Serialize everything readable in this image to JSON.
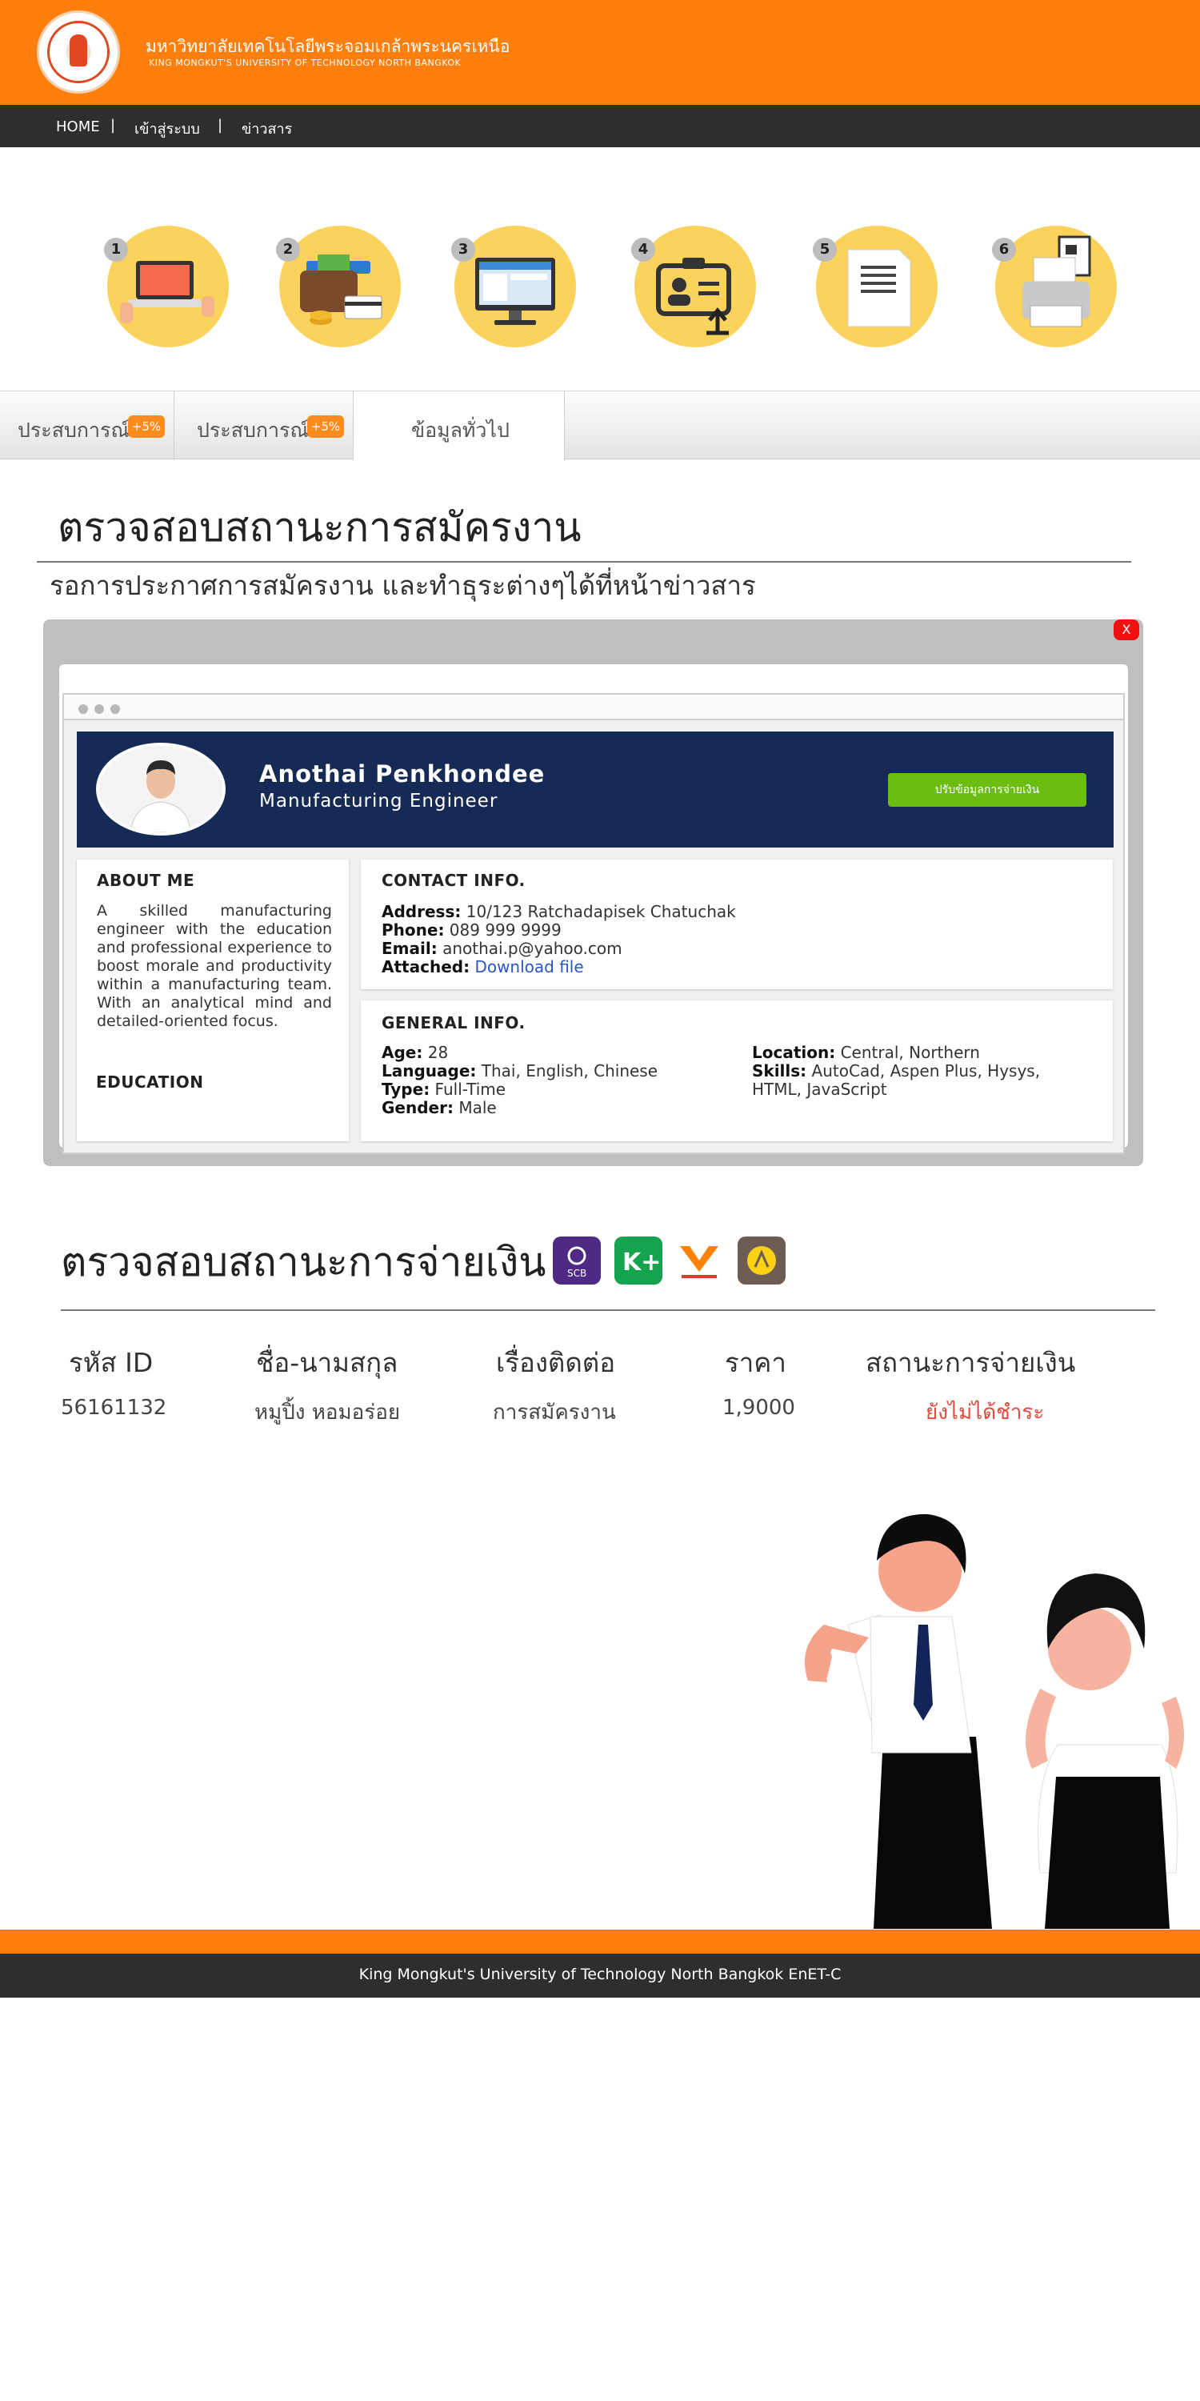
{
  "header": {
    "university_th": "มหาวิทยาลัยเทคโนโลยีพระจอมเกล้าพระนครเหนือ",
    "university_en": "KING MONGKUT'S UNIVERSITY OF TECHNOLOGY NORTH BANGKOK"
  },
  "nav": {
    "items": [
      {
        "label": "HOME"
      },
      {
        "label": "เข้าสู่ระบบ"
      },
      {
        "label": "ข่าวสาร"
      }
    ],
    "separator": "|"
  },
  "steps": [
    {
      "number": "1",
      "icon": "laptop-icon"
    },
    {
      "number": "2",
      "icon": "wallet-icon"
    },
    {
      "number": "3",
      "icon": "monitor-icon"
    },
    {
      "number": "4",
      "icon": "id-card-upload-icon"
    },
    {
      "number": "5",
      "icon": "document-icon"
    },
    {
      "number": "6",
      "icon": "printer-icon"
    }
  ],
  "tabs": [
    {
      "label": "ประสบการณ์",
      "badge": "+5%"
    },
    {
      "label": "ประสบการณ์",
      "badge": "+5%"
    },
    {
      "label": "ข้อมูลทั่วไป",
      "badge": ""
    }
  ],
  "application_status": {
    "title": "ตรวจสอบสถานะการสมัครงาน",
    "subtitle": "รอการประกาศการสมัครงาน และทำธุระต่างๆได้ที่หน้าข่าวสาร"
  },
  "modal": {
    "close_label": "X",
    "profile": {
      "name": "Anothai Penkhondee",
      "role": "Manufacturing Engineer",
      "edit_button": "ปรับข้อมูลการจ่ายเงิน"
    },
    "about": {
      "heading": "ABOUT ME",
      "text": "A skilled manufacturing engineer with the education and professional experience to boost morale and productivity within a manufacturing team. With an analytical mind and detailed-oriented focus.",
      "education_heading": "EDUCATION"
    },
    "contact": {
      "heading": "CONTACT INFO.",
      "address_label": "Address:",
      "address": "10/123 Ratchadapisek Chatuchak",
      "phone_label": "Phone:",
      "phone": "089 999 9999",
      "email_label": "Email:",
      "email": "anothai.p@yahoo.com",
      "attached_label": "Attached:",
      "attached_link": "Download file"
    },
    "general": {
      "heading": "GENERAL INFO.",
      "age_label": "Age:",
      "age": "28",
      "language_label": "Language:",
      "language": "Thai, English, Chinese",
      "type_label": "Type:",
      "type": "Full-Time",
      "gender_label": "Gender:",
      "gender": "Male",
      "location_label": "Location:",
      "location": "Central, Northern",
      "skills_label": "Skills:",
      "skills_line1": "AutoCad, Aspen Plus, Hysys,",
      "skills_line2": "HTML, JavaScript"
    }
  },
  "payment_status": {
    "title": "ตรวจสอบสถานะการจ่ายเงิน",
    "methods": [
      {
        "name": "SCB",
        "icon": "scb-icon",
        "color": "#4e2a84"
      },
      {
        "name": "K+",
        "icon": "kplus-icon",
        "color": "#14a44d"
      },
      {
        "name": "truemoney",
        "icon": "truemoney-icon",
        "color": "#ff8200"
      },
      {
        "name": "Krungsri",
        "icon": "krungsri-icon",
        "color": "#6d5c54"
      }
    ],
    "table": {
      "headers": [
        "รหัส ID",
        "ชื่อ-นามสกุล",
        "เรื่องติดต่อ",
        "ราคา",
        "สถานะการจ่ายเงิน"
      ],
      "row": {
        "id": "56161132",
        "name": "หมูปิ้ง  หอมอร่อย",
        "subject": "การสมัครงาน",
        "price": "1,9000",
        "status": "ยังไม่ได้ชำระ"
      }
    }
  },
  "footer": {
    "text": "King Mongkut's University of Technology North Bangkok EnET-C"
  },
  "colors": {
    "brand_orange": "#ff7f0e",
    "nav_dark": "#2e2e2e",
    "profile_navy": "#152a55",
    "edit_green": "#6cbd12",
    "unpaid_red": "#e04b3b"
  }
}
